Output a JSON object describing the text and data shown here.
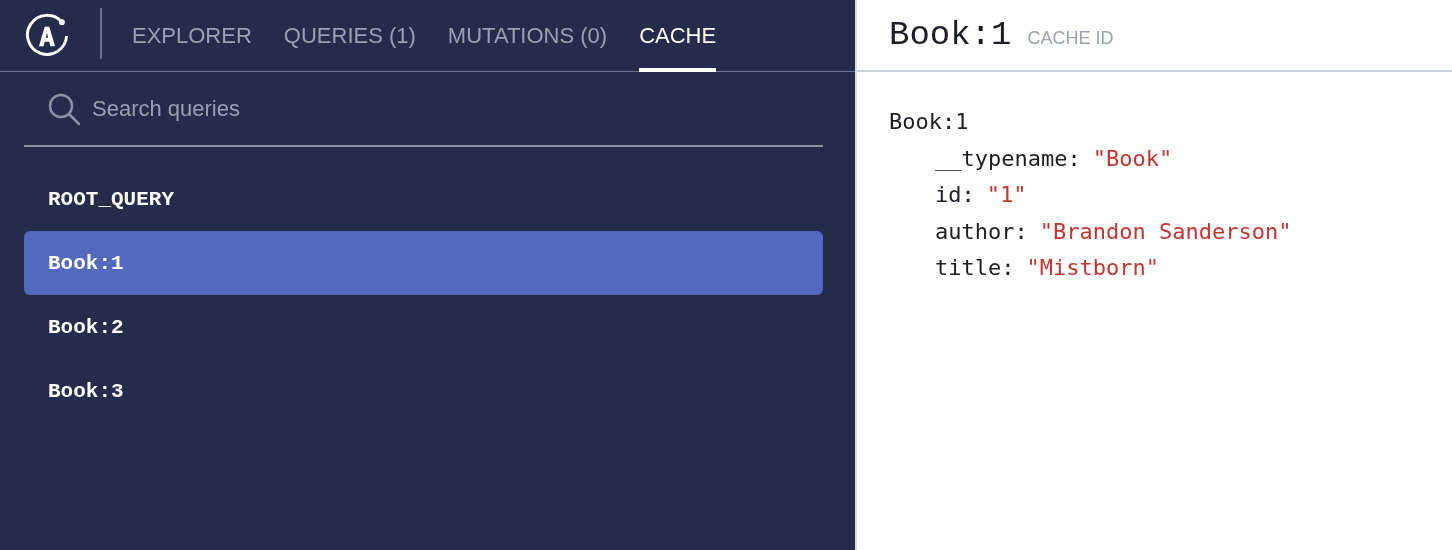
{
  "tabs": [
    {
      "label": "EXPLORER",
      "selected": false
    },
    {
      "label": "QUERIES (1)",
      "selected": false
    },
    {
      "label": "MUTATIONS (0)",
      "selected": false
    },
    {
      "label": "CACHE",
      "selected": true
    }
  ],
  "search": {
    "placeholder": "Search queries"
  },
  "cache_items": [
    {
      "label": "ROOT_QUERY",
      "selected": false
    },
    {
      "label": "Book:1",
      "selected": true
    },
    {
      "label": "Book:2",
      "selected": false
    },
    {
      "label": "Book:3",
      "selected": false
    }
  ],
  "detail": {
    "title": "Book:1",
    "subtitle": "CACHE ID",
    "object_name": "Book:1",
    "fields": [
      {
        "key": "__typename:",
        "value": "\"Book\""
      },
      {
        "key": "id:",
        "value": "\"1\""
      },
      {
        "key": "author:",
        "value": "\"Brandon Sanderson\""
      },
      {
        "key": "title:",
        "value": "\"Mistborn\""
      }
    ]
  }
}
